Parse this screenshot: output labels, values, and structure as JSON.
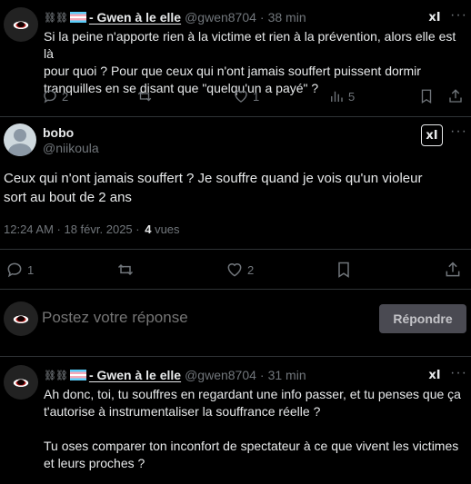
{
  "top_tweet": {
    "links_glyph": "⛓⛓",
    "name": "- Gwen à le elle",
    "handle": "@gwen8704",
    "separator": "·",
    "time": "38 min",
    "text_line1": "Si la peine n'apporte rien à la victime et rien à la prévention, alors elle est là",
    "text_line2": "pour quoi ? Pour que ceux qui n'ont jamais souffert puissent dormir",
    "text_line3": "tranquilles en se disant que \"quelqu'un a payé\" ?",
    "replies": "2",
    "likes": "1",
    "views": "5"
  },
  "main_tweet": {
    "display_name": "bobo",
    "handle": "@niikoula",
    "text_line1": "Ceux qui n'ont jamais souffert ? Je souffre quand je vois qu'un violeur",
    "text_line2": "sort au bout de 2 ans",
    "timestamp": "12:24 AM · 18 févr. 2025 ·",
    "views_count": "4",
    "views_label": "vues",
    "replies": "1",
    "likes": "2"
  },
  "composer": {
    "placeholder": "Postez votre réponse",
    "button": "Répondre"
  },
  "reply_tweet": {
    "links_glyph": "⛓⛓",
    "name": "- Gwen à le elle",
    "handle": "@gwen8704",
    "separator": "·",
    "time": "31 min",
    "text_line1": "Ah donc, toi, tu souffres en regardant une info passer, et tu penses que ça",
    "text_line2": "t'autorise à instrumentaliser la souffrance réelle ?",
    "text_line3": "Tu oses comparer ton inconfort de spectateur à ce que vivent les victimes",
    "text_line4": "et leurs proches ?"
  },
  "icons": {
    "grok": "xI",
    "more": "···"
  },
  "colors": {
    "background": "#000000",
    "text": "#e7e9ea",
    "muted": "#71767b",
    "divider": "#2f3336",
    "reply_button": "#4a4a52"
  }
}
